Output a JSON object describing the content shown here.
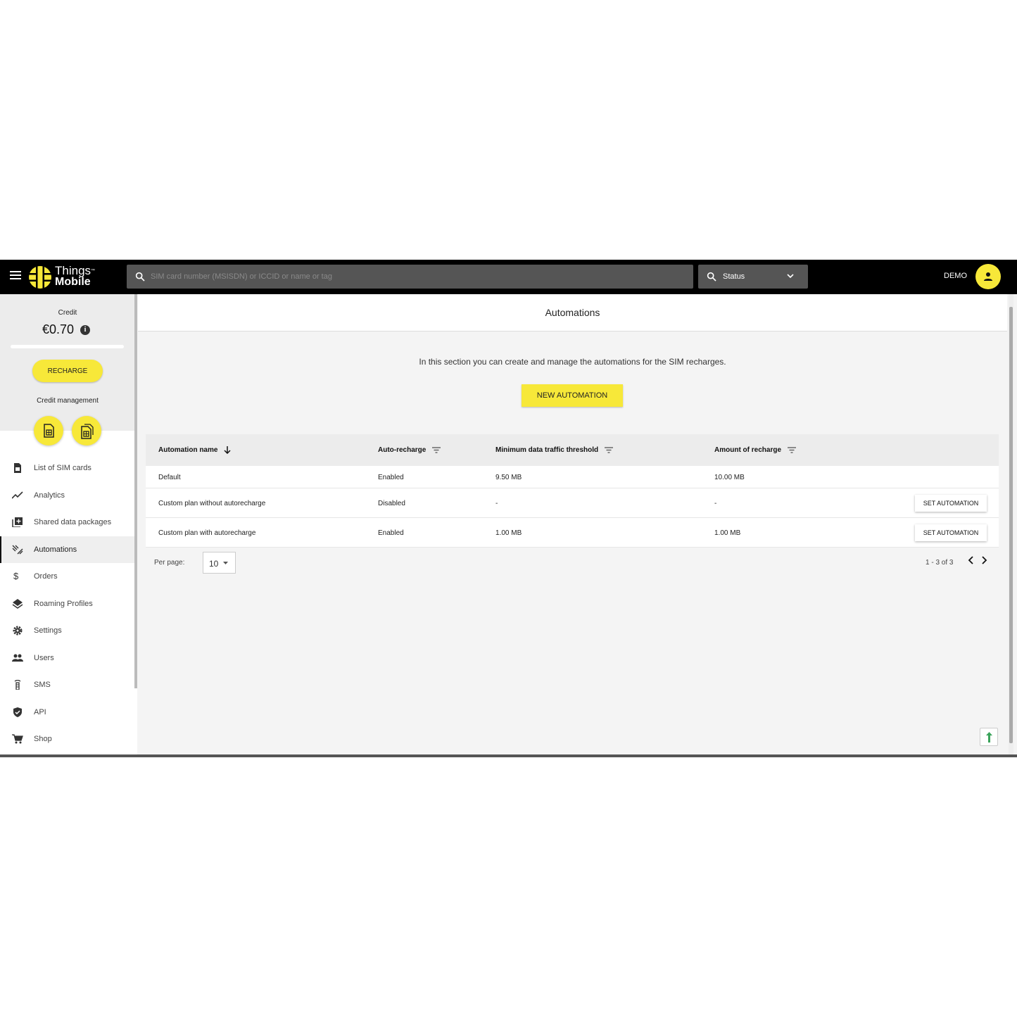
{
  "header": {
    "logo_line1": "Things",
    "logo_tm": "™",
    "logo_line2": "Mobile",
    "search_placeholder": "SIM card number (MSISDN) or ICCID or name or tag",
    "status_label": "Status",
    "user_label": "DEMO"
  },
  "sidebar": {
    "credit_label": "Credit",
    "credit_amount": "€0.70",
    "info_glyph": "i",
    "recharge_label": "RECHARGE",
    "credit_management_label": "Credit management",
    "items": [
      {
        "label": "List of SIM cards",
        "icon": "sim-card-icon"
      },
      {
        "label": "Analytics",
        "icon": "trend-line-icon"
      },
      {
        "label": "Shared data packages",
        "icon": "library-add-icon"
      },
      {
        "label": "Automations",
        "icon": "automation-icon"
      },
      {
        "label": "Orders",
        "icon": "dollar-icon"
      },
      {
        "label": "Roaming Profiles",
        "icon": "layers-icon"
      },
      {
        "label": "Settings",
        "icon": "gear-icon"
      },
      {
        "label": "Users",
        "icon": "users-icon"
      },
      {
        "label": "SMS",
        "icon": "antenna-icon"
      },
      {
        "label": "API",
        "icon": "shield-icon"
      },
      {
        "label": "Shop",
        "icon": "cart-icon"
      }
    ],
    "active_item": "Automations"
  },
  "main": {
    "title": "Automations",
    "description": "In this section you can create and manage the automations for the SIM recharges.",
    "new_automation_label": "NEW AUTOMATION",
    "table": {
      "columns": [
        "Automation name",
        "Auto-recharge",
        "Minimum data traffic threshold",
        "Amount of recharge"
      ],
      "rows": [
        {
          "name": "Default",
          "auto_recharge": "Enabled",
          "threshold": "9.50 MB",
          "amount": "10.00 MB",
          "action": ""
        },
        {
          "name": "Custom plan without autorecharge",
          "auto_recharge": "Disabled",
          "threshold": "-",
          "amount": "-",
          "action": "SET AUTOMATION"
        },
        {
          "name": "Custom plan with autorecharge",
          "auto_recharge": "Enabled",
          "threshold": "1.00 MB",
          "amount": "1.00 MB",
          "action": "SET AUTOMATION"
        }
      ]
    },
    "pagination": {
      "per_page_label": "Per page:",
      "per_page_value": "10",
      "range": "1 - 3 of 3"
    }
  },
  "colors": {
    "brand_yellow": "#f7e839",
    "topbar": "#000000",
    "search_bg": "#555555"
  }
}
